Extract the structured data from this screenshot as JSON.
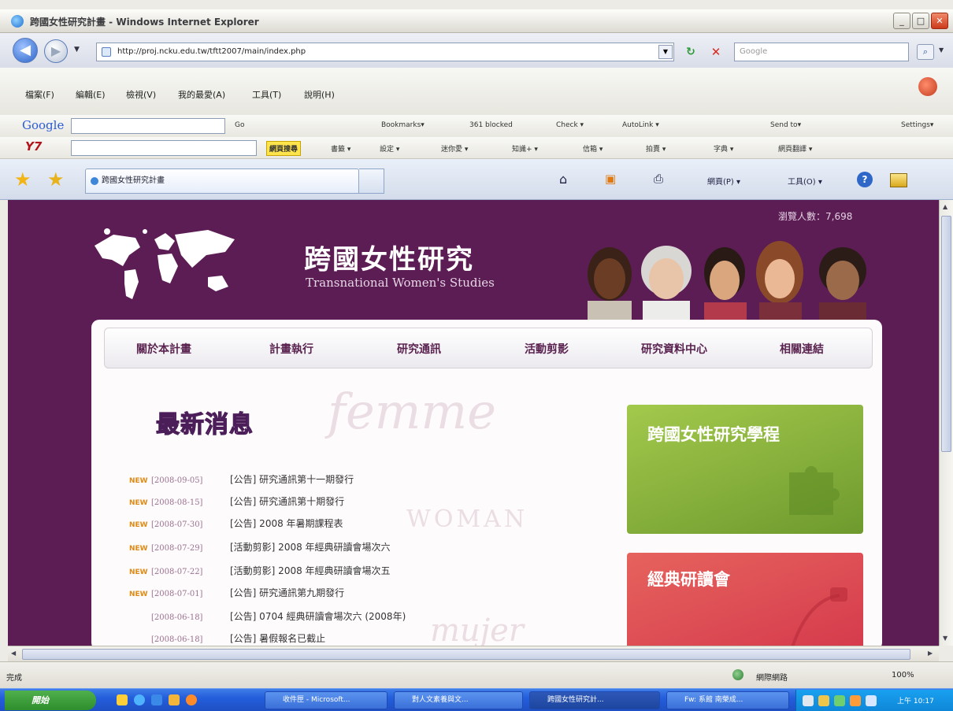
{
  "window": {
    "title": "跨國女性研究計畫 - Windows Internet Explorer",
    "minimize": "_",
    "maximize": "□",
    "close": "✕"
  },
  "address": {
    "url": "http://proj.ncku.edu.tw/tftt2007/main/index.php",
    "search_placeholder": "Google",
    "go": "↻",
    "stop": "✕"
  },
  "menu": [
    "檔案(F)",
    "編輯(E)",
    "檢視(V)",
    "我的最愛(A)",
    "工具(T)",
    "說明(H)"
  ],
  "google_toolbar": {
    "logo": "Google",
    "items": [
      "Go",
      "Bookmarks▾",
      "361 blocked",
      "Check ▾",
      "AutoLink ▾",
      "Send to▾",
      "Settings▾"
    ]
  },
  "yahoo_toolbar": {
    "logo": "Y7",
    "items": [
      "網頁搜尋",
      "書籤 ▾",
      "設定 ▾",
      "迷你愛 ▾",
      "知識+ ▾",
      "信箱 ▾",
      "拍賣 ▾",
      "字典 ▾",
      "網頁翻譯 ▾"
    ]
  },
  "tab": {
    "label": "跨國女性研究計畫"
  },
  "commands": [
    "網頁(P) ▾",
    "工具(O) ▾"
  ],
  "site": {
    "title": "跨國女性研究",
    "subtitle": "Transnational Women's Studies",
    "visitor": "瀏覽人數：7,698",
    "nav": [
      "關於本計畫",
      "計畫執行",
      "研究通訊",
      "活動剪影",
      "研究資料中心",
      "相關連結"
    ],
    "news_title": "最新消息",
    "watermarks": [
      "femme",
      "WOMAN",
      "mujer"
    ],
    "news": [
      {
        "badge": "NEW",
        "date": "[2008-09-05]",
        "text": "[公告] 研究通訊第十一期發行"
      },
      {
        "badge": "NEW",
        "date": "[2008-08-15]",
        "text": "[公告] 研究通訊第十期發行"
      },
      {
        "badge": "NEW",
        "date": "[2008-07-30]",
        "text": "[公告] 2008 年暑期課程表"
      },
      {
        "badge": "NEW",
        "date": "[2008-07-29]",
        "text": "[活動剪影] 2008 年經典研讀會場次六"
      },
      {
        "badge": "NEW",
        "date": "[2008-07-22]",
        "text": "[活動剪影] 2008 年經典研讀會場次五"
      },
      {
        "badge": "NEW",
        "date": "[2008-07-01]",
        "text": "[公告] 研究通訊第九期發行"
      },
      {
        "badge": "",
        "date": "[2008-06-18]",
        "text": "[公告] 0704 經典研讀會場次六 (2008年)"
      },
      {
        "badge": "",
        "date": "[2008-06-18]",
        "text": "[公告] 暑假報名已截止"
      }
    ],
    "promos": [
      "跨國女性研究學程",
      "經典研讀會"
    ]
  },
  "status": {
    "text": "完成",
    "zone": "網際網路",
    "zoom": "100%"
  },
  "taskbar": {
    "start": "開始",
    "buttons": [
      "收件匣 - Microsoft...",
      "對人文素養與文...",
      "跨國女性研究計...",
      "Fw: 系館 南榮成..."
    ],
    "clock": "上午 10:17"
  },
  "colors": {
    "brand_purple": "#5c1d55",
    "promo_green": "#8ab43d",
    "promo_red": "#e04c55",
    "badge_orange": "#e08a16"
  }
}
